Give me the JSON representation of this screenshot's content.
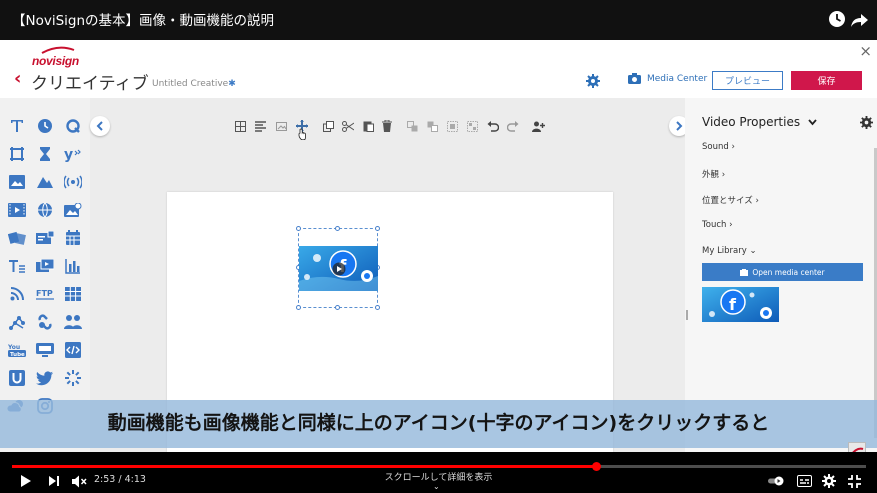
{
  "video": {
    "title": "【NoviSignの基本】画像・動画機能の説明",
    "subtitle": "動画機能も画像機能と同様に上のアイコン(十字のアイコン)をクリックすると",
    "time": "2:53 / 4:13",
    "progress": 0.684,
    "scroll_hint": "スクロールして詳細を表示",
    "accent_color": "#ff0000"
  },
  "app": {
    "close_label": "×",
    "logo_text": "novisign",
    "back_glyph": "‹",
    "app_name": "クリエイティブ",
    "creative_name": "Untitled Creative",
    "creative_modified_mark": "✱",
    "media_center_label": "Media Center",
    "preview_label": "プレビュー",
    "save_label": "保存",
    "colors": {
      "brand": "#c8102e",
      "primary": "#3c7bc6",
      "save": "#d0174b"
    }
  },
  "properties": {
    "title": "Video Properties",
    "items": [
      "Sound ›",
      "外観 ›",
      "位置とサイズ ›",
      "Touch ›",
      "My Library ⌄"
    ],
    "open_media_label": "Open media center"
  },
  "widgets": [
    "text-icon",
    "clock-icon",
    "rss-q-icon",
    "crop-icon",
    "hourglass-icon",
    "yelp-icon",
    "image-icon",
    "slideshow-icon",
    "broadcast-icon",
    "video-icon",
    "globe-icon",
    "image-gallery-icon",
    "flip-icon",
    "ticker-icon",
    "calendar-icon",
    "text-format-icon",
    "media-playlist-icon",
    "bar-chart-icon",
    "rss-feed-icon",
    "ftp-icon",
    "table-icon",
    "social-icon",
    "link-icon",
    "people-icon",
    "youtube-icon",
    "screen-icon",
    "code-icon",
    "u-icon",
    "twitter-icon",
    "loading-icon",
    "weather-icon",
    "instagram-icon"
  ],
  "toolbar_icons": [
    "grid-icon",
    "align-icon",
    "image-frame-icon",
    "move-crosshair-icon",
    "copy-icon",
    "cut-icon",
    "paste-icon",
    "delete-icon",
    "bring-front-icon",
    "send-back-icon",
    "group-icon",
    "ungroup-icon",
    "undo-icon",
    "redo-icon",
    "add-user-icon"
  ]
}
